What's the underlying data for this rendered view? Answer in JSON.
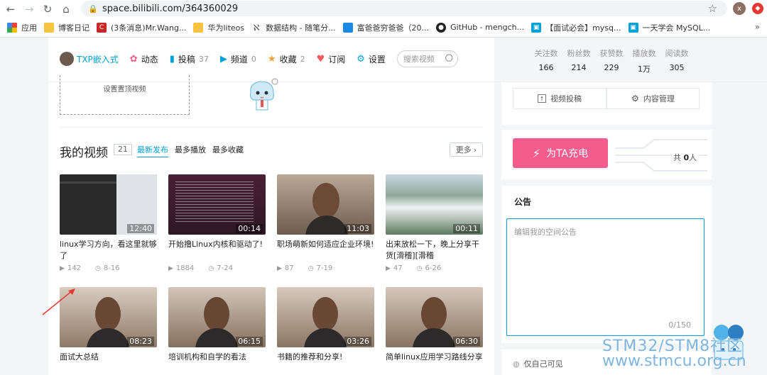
{
  "browser": {
    "url": "space.bilibili.com/364360029",
    "profile_initial": "x",
    "bookmarks": [
      {
        "label": "应用",
        "color": "#1a73e8"
      },
      {
        "label": "博客日记",
        "color": "#f6c342"
      },
      {
        "label": "(3条消息)Mr.Wang...",
        "color": "#c62828"
      },
      {
        "label": "华为liteos",
        "color": "#f6c342"
      },
      {
        "label": "数据结构 - 随笔分...",
        "color": "#555555"
      },
      {
        "label": "富爸爸穷爸爸（20...",
        "color": "#1e88e5"
      },
      {
        "label": "GitHub - mengch...",
        "color": "#222222"
      },
      {
        "label": "【面试必会】mysq...",
        "color": "#00a1d6"
      },
      {
        "label": "一天学会 MySQL...",
        "color": "#00a1d6"
      }
    ],
    "more": "»"
  },
  "nav": {
    "user": "TXP嵌入式",
    "tabs": [
      {
        "label": "动态",
        "count": "",
        "icon": "dynamic-icon",
        "color": "#f25d8e"
      },
      {
        "label": "投稿",
        "count": "37",
        "icon": "upload-icon",
        "color": "#00a1d6"
      },
      {
        "label": "频道",
        "count": "0",
        "icon": "channel-icon",
        "color": "#00a1d6"
      },
      {
        "label": "收藏",
        "count": "2",
        "icon": "favorite-icon",
        "color": "#f3a034"
      },
      {
        "label": "订阅",
        "count": "",
        "icon": "subscribe-icon",
        "color": "#f45a5a"
      },
      {
        "label": "设置",
        "count": "",
        "icon": "settings-icon",
        "color": "#00a1d6"
      }
    ],
    "search_placeholder": "搜索视频"
  },
  "stats": [
    {
      "label": "关注数",
      "value": "166"
    },
    {
      "label": "粉丝数",
      "value": "214"
    },
    {
      "label": "获赞数",
      "value": "229"
    },
    {
      "label": "播放数",
      "value": "1万"
    },
    {
      "label": "阅读数",
      "value": "305"
    }
  ],
  "pin": {
    "label": "设置置顶视频"
  },
  "videos_section": {
    "title": "我的视频",
    "count": "21",
    "sorts": [
      "最新发布",
      "最多播放",
      "最多收藏"
    ],
    "more": "更多"
  },
  "videos": [
    {
      "title": "linux学习方向，看这里就够了",
      "duration": "12:40",
      "plays": "142",
      "date": "8-16",
      "bg": "#2a2a2a"
    },
    {
      "title": "开始撸Linux内核和驱动了!",
      "duration": "00:14",
      "plays": "1884",
      "date": "7-24",
      "bg": "#3b1f2b"
    },
    {
      "title": "职场萌新如何适应企业环境!",
      "duration": "11:03",
      "plays": "87",
      "date": "7-19",
      "bg": "#8a7766"
    },
    {
      "title": "出来放松一下，晚上分享干货[滑稽][滑稽",
      "duration": "00:11",
      "plays": "47",
      "date": "6-26",
      "bg": "#7a9c7e"
    },
    {
      "title": "面试大总结",
      "duration": "08:23",
      "plays": "",
      "date": "",
      "bg": "#9a8372"
    },
    {
      "title": "培训机构和自学的看法",
      "duration": "06:15",
      "plays": "",
      "date": "",
      "bg": "#8e7a6a"
    },
    {
      "title": "书籍的推荐和分享!",
      "duration": "03:26",
      "plays": "",
      "date": "",
      "bg": "#958170"
    },
    {
      "title": "简单linux应用学习路线分享",
      "duration": "06:30",
      "plays": "",
      "date": "",
      "bg": "#927d6c"
    }
  ],
  "right": {
    "upload_btn": "视频投稿",
    "manage_btn": "内容管理",
    "charge_btn": "为TA充电",
    "charge_total_prefix": "共",
    "charge_total": "0",
    "charge_total_suffix": "人",
    "notice_title": "公告",
    "notice_placeholder": "编辑我的空间公告",
    "notice_counter": "0/150",
    "visibility": "仅自己可见"
  },
  "watermark": {
    "line1": "STM32/STM8社区",
    "line2": "www.stmcu.org.cn"
  }
}
